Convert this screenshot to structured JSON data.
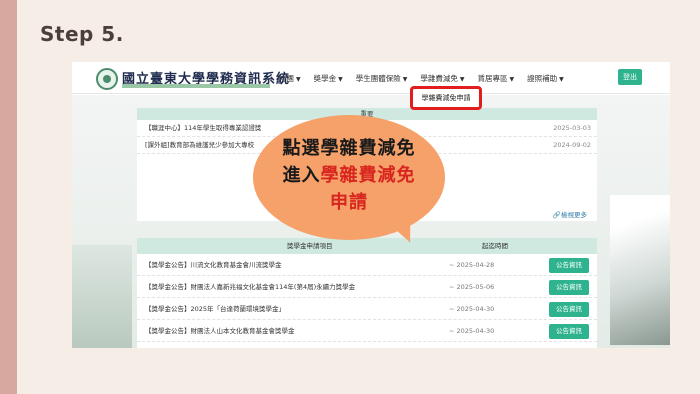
{
  "slide": {
    "step_title": "Step 5."
  },
  "site": {
    "title": "國立臺東大學學務資訊系統",
    "nav": [
      {
        "label": "社團"
      },
      {
        "label": "獎學金"
      },
      {
        "label": "學生團體保險"
      },
      {
        "label": "學雜費減免"
      },
      {
        "label": "賃居專區"
      },
      {
        "label": "證照補助"
      }
    ],
    "login_label": "登出",
    "dropdown_item": "學雜費減免申請"
  },
  "news": {
    "header": "重要",
    "items": [
      {
        "title": "【職涯中心】114年學生取得專業認證獎",
        "date": "2025-03-03"
      },
      {
        "title": "[課外組]教育部為維護兒少參加大專校",
        "date": "2024-09-02"
      }
    ],
    "more_label": "檢視更多"
  },
  "scholarships": {
    "header_title": "獎學金申請項目",
    "header_time": "起迄時間",
    "button_label": "公告資訊",
    "rows": [
      {
        "title": "【獎學金公告】川流文化教育基金會川流獎學金",
        "date": "~ 2025-04-28"
      },
      {
        "title": "【獎學金公告】財團法人嘉新兆福文化基金會114年(第4屆)永續力獎學金",
        "date": "~ 2025-05-06"
      },
      {
        "title": "【獎學金公告】2025年「台達荷蘭環境獎學金」",
        "date": "~ 2025-04-30"
      },
      {
        "title": "【獎學金公告】財團法人山本文化教育基金會獎學金",
        "date": "~ 2025-04-30"
      }
    ]
  },
  "callout": {
    "line1": "點選學雜費減免",
    "line2_prefix": "進入",
    "line2_highlight": "學雜費減免",
    "line3": "申請"
  },
  "colors": {
    "accent_green": "#2fb38f",
    "highlight_red": "#e11d1d",
    "callout_orange": "#f5a169"
  }
}
